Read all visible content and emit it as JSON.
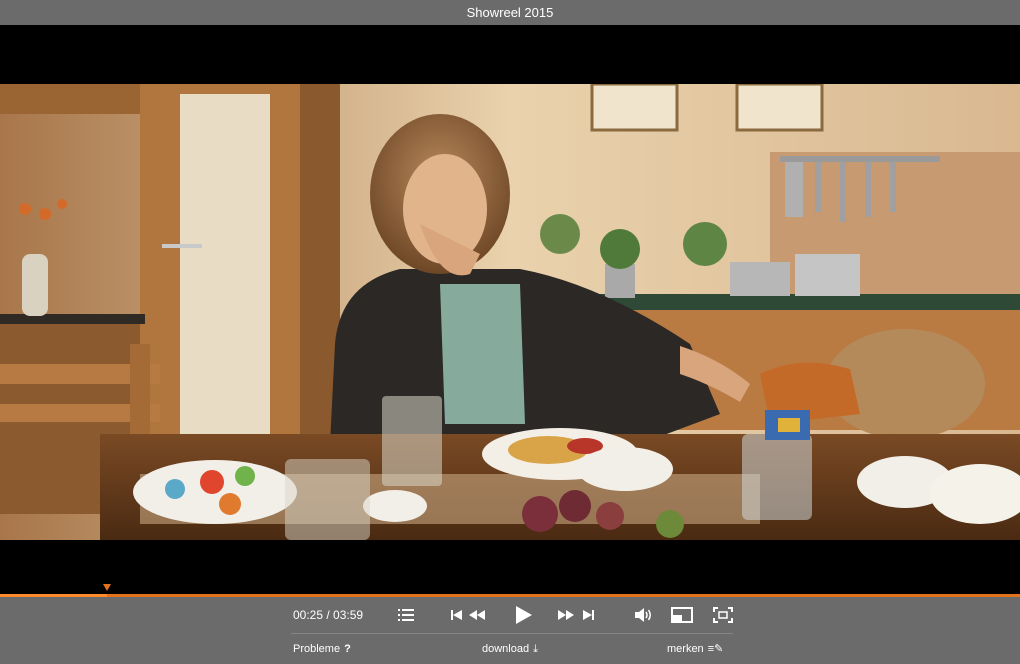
{
  "window": {
    "title": "Showreel 2015"
  },
  "player": {
    "time_display": "00:25 / 03:59",
    "progress": 0.105,
    "accent_color": "#e4721b"
  },
  "controls": {
    "chapters_icon": "list-icon",
    "skip_back_icon": "skip-back-icon",
    "rewind_icon": "rewind-icon",
    "play_icon": "play-icon",
    "forward_icon": "fast-forward-icon",
    "skip_forward_icon": "skip-forward-icon",
    "volume_icon": "volume-icon",
    "pip_icon": "picture-in-picture-icon",
    "fullscreen_icon": "fullscreen-icon"
  },
  "links": {
    "problems": "Probleme",
    "problems_glyph": "?",
    "download": "download",
    "download_glyph": "⤓",
    "remember": "merken",
    "remember_glyph": "≡✎"
  }
}
